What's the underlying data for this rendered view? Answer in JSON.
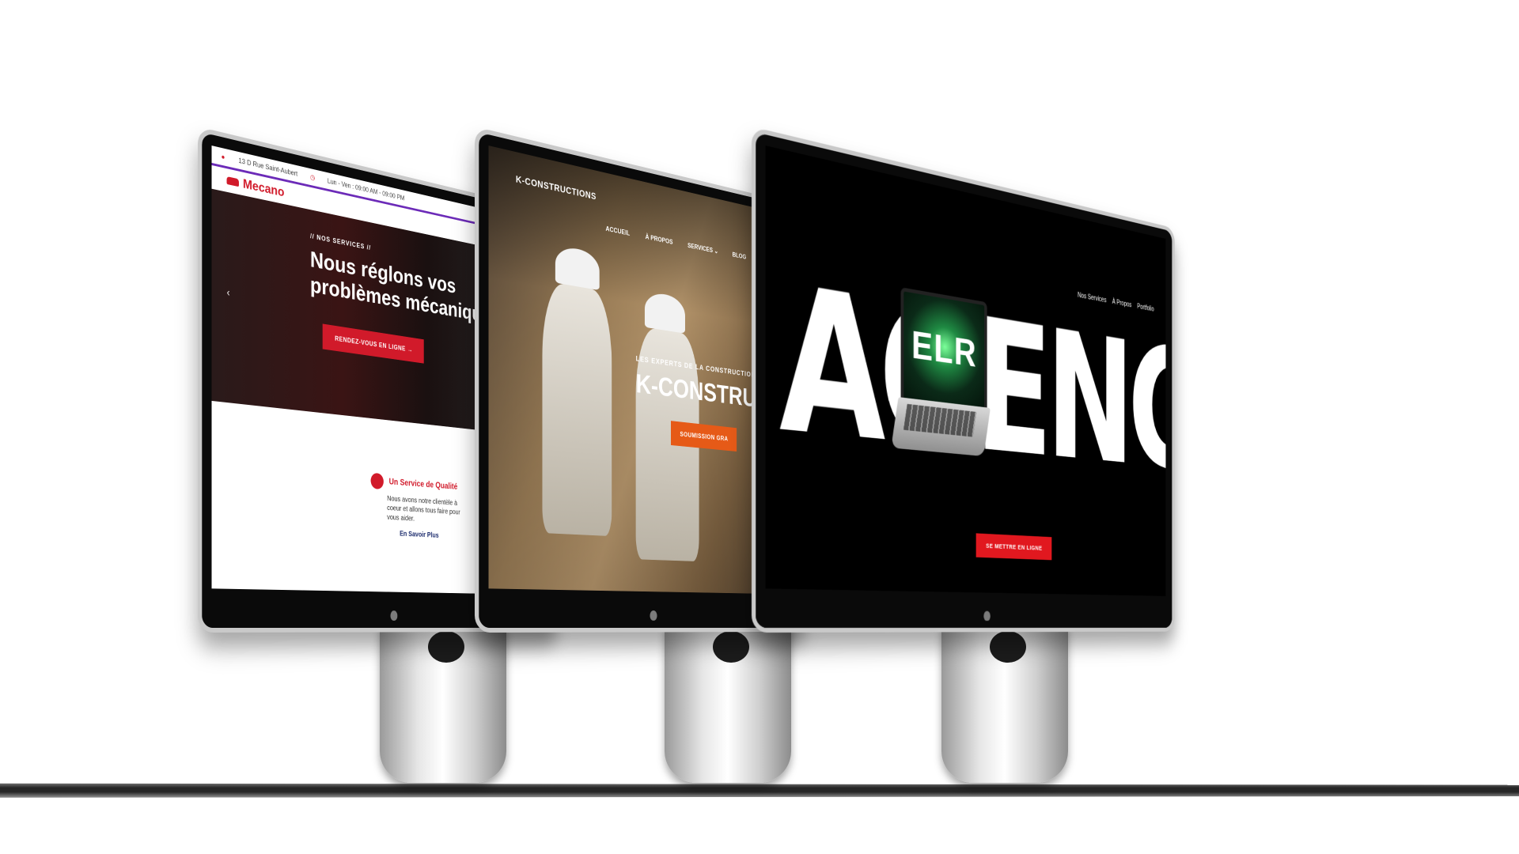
{
  "mecano": {
    "address": "13 D Rue Saint-Aubert",
    "hours": "Lun - Ven : 09:00 AM - 09:00 PM",
    "logo": "Mecano",
    "tag": "// NOS SERVICES //",
    "headline": "Nous réglons vos problèmes mécaniques",
    "cta": "RENDEZ-VOUS EN LIGNE →",
    "card_title": "Un Service de Qualité",
    "card_text": "Nous avons notre clientèle à coeur et allons tous faire pour vous aider.",
    "card_link": "En Savoir Plus",
    "accent": "#d11a2a"
  },
  "kcon": {
    "logo": "K-CONSTRUCTIONS",
    "nav": [
      "ACCUEIL",
      "À PROPOS",
      "SERVICES ⌄",
      "BLOG"
    ],
    "tag": "LES EXPERTS DE LA CONSTRUCTION SUR",
    "title": "K-CONSTRU",
    "cta": "SOUMISSION GRA",
    "accent": "#e65a17"
  },
  "agence": {
    "nav": [
      "Nos Services",
      "À Propos",
      "Portfolio"
    ],
    "word": "AGENCE",
    "laptop_text": "ELR",
    "cta": "SE METTRE EN LIGNE",
    "accent": "#e1181f"
  }
}
